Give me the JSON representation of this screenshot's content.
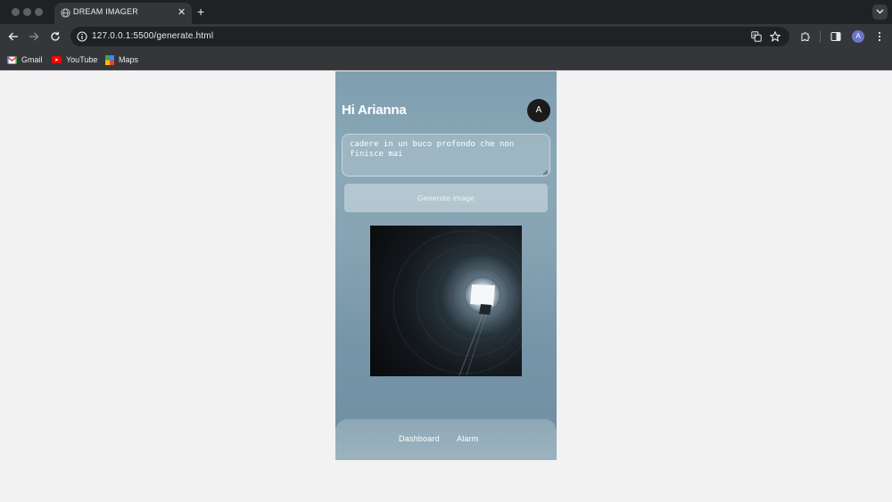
{
  "browser": {
    "tab": {
      "title": "DREAM IMAGER",
      "close": "✕"
    },
    "new_tab": "+",
    "url": "127.0.0.1:5500/generate.html",
    "profile_initial": "A",
    "bookmarks": [
      {
        "label": "Gmail",
        "icon": "gmail-icon"
      },
      {
        "label": "YouTube",
        "icon": "youtube-icon"
      },
      {
        "label": "Maps",
        "icon": "maps-icon"
      }
    ]
  },
  "app": {
    "greeting": "Hi Arianna",
    "avatar_initial": "A",
    "prompt_text": "cadere in un buco profondo che non finisce mai",
    "generate_label": "Generate image",
    "nav": {
      "dashboard": "Dashboard",
      "alarm": "Alarm"
    }
  }
}
